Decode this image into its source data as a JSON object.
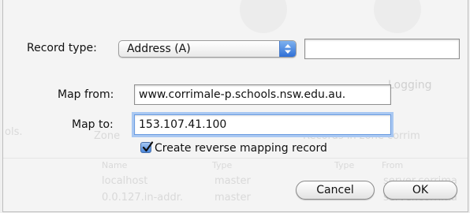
{
  "form": {
    "record_type_label": "Record type:",
    "record_type_value": "Address (A)",
    "record_type_extra_value": "",
    "map_from_label": "Map from:",
    "map_from_value": "www.corrimale-p.schools.nsw.edu.au.",
    "map_to_label": "Map to:",
    "map_to_value": "153.107.41.100",
    "reverse_mapping_label": "Create reverse mapping record",
    "reverse_mapping_checked": true
  },
  "buttons": {
    "cancel_label": "Cancel",
    "ok_label": "OK"
  },
  "background_window": {
    "tab_label": "Logging",
    "zone_label": "Zone",
    "records_label": "Records in zone corrim",
    "sidebar_label": "ols.",
    "columns": [
      "Name",
      "Type",
      "Type",
      "From"
    ],
    "rows": [
      [
        "localhost",
        "master",
        "",
        "server.corrima"
      ],
      [
        "0.0.127.in-addr.",
        "master",
        "",
        "server.corrima"
      ]
    ]
  },
  "icons": {
    "popup_arrows": "updown-arrows-icon",
    "checkmark": "checkmark-icon"
  },
  "colors": {
    "accent": "#3b7bdb",
    "focus_ring": "#a9c8f2"
  }
}
